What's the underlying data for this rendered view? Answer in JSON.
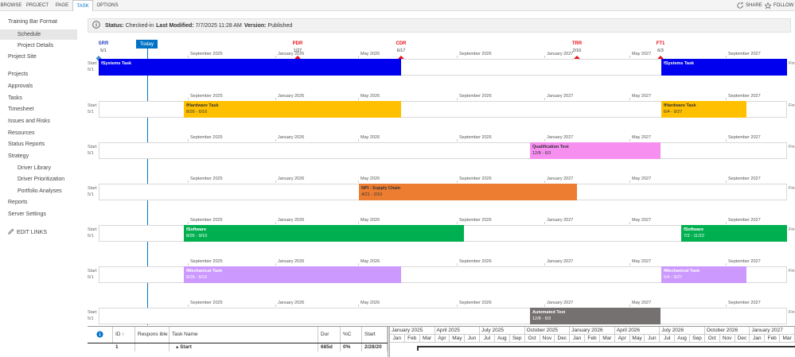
{
  "ribbon": {
    "tabs": [
      {
        "label": "BROWSE",
        "active": false
      },
      {
        "label": "PROJECT",
        "active": false
      },
      {
        "label": "PAGE",
        "active": false
      },
      {
        "label": "TASK",
        "active": true
      },
      {
        "label": "OPTIONS",
        "active": false
      }
    ],
    "share_label": "SHARE",
    "follow_label": "FOLLOW"
  },
  "nav": {
    "items": [
      {
        "label": "Training Bar Format",
        "level": 0,
        "selected": false
      },
      {
        "label": "Schedule",
        "level": 1,
        "selected": true
      },
      {
        "label": "Project Details",
        "level": 1,
        "selected": false
      },
      {
        "label": "Project Site",
        "level": 0,
        "selected": false
      },
      {
        "label": "Projects",
        "level": 0,
        "selected": false
      },
      {
        "label": "Approvals",
        "level": 0,
        "selected": false
      },
      {
        "label": "Tasks",
        "level": 0,
        "selected": false
      },
      {
        "label": "Timesheet",
        "level": 0,
        "selected": false
      },
      {
        "label": "Issues and Risks",
        "level": 0,
        "selected": false
      },
      {
        "label": "Resources",
        "level": 0,
        "selected": false
      },
      {
        "label": "Status Reports",
        "level": 0,
        "selected": false
      },
      {
        "label": "Strategy",
        "level": 0,
        "selected": false
      },
      {
        "label": "Driver Library",
        "level": 1,
        "selected": false
      },
      {
        "label": "Driver Prioritization",
        "level": 1,
        "selected": false
      },
      {
        "label": "Portfolio Analyses",
        "level": 1,
        "selected": false
      },
      {
        "label": "Reports",
        "level": 0,
        "selected": false
      },
      {
        "label": "Server Settings",
        "level": 0,
        "selected": false
      }
    ],
    "edit_links": "EDIT LINKS"
  },
  "status": {
    "status_label": "Status:",
    "status_value": "Checked-in",
    "modified_label": "Last Modified:",
    "modified_value": "7/7/2025 11:28 AM",
    "version_label": "Version:",
    "version_value": "Published"
  },
  "timeline": {
    "today_label": "Today",
    "start_label": "Start",
    "start_date": "5/1",
    "finish_label": "Fin",
    "milestones": [
      {
        "name": "SRR",
        "date": "5/1",
        "color": "#1f3fbf",
        "diamond_color": "#4a90c8"
      },
      {
        "name": "PDR",
        "date": "1/27",
        "color": "#e8141b",
        "diamond_color": "#e8141b"
      },
      {
        "name": "CDR",
        "date": "6/17",
        "color": "#e8141b",
        "diamond_color": "#e8141b"
      },
      {
        "name": "TRR",
        "date": "2/10",
        "color": "#e8141b",
        "diamond_color": "#e8141b"
      },
      {
        "name": "FT1",
        "date": "6/3",
        "color": "#e8141b",
        "diamond_color": "#e8141b"
      }
    ],
    "month_labels": [
      "September 2025",
      "January 2026",
      "May 2026",
      "September 2026",
      "January 2027",
      "May 2027",
      "September 2027"
    ],
    "rows": [
      {
        "bars": [
          {
            "name": "fSystems Task",
            "dates": "",
            "color": "#0000ee",
            "text_color": "#ffffff"
          },
          {
            "name": "fSystems Task",
            "dates": "",
            "color": "#0000ee",
            "text_color": "#ffffff"
          }
        ]
      },
      {
        "bars": [
          {
            "name": "fHardware Task",
            "dates": "8/26 - 6/16",
            "color": "#ffc000",
            "text_color": "#333333"
          },
          {
            "name": "fHardware Task",
            "dates": "6/4 - 9/27",
            "color": "#ffc000",
            "text_color": "#333333"
          }
        ]
      },
      {
        "bars": [
          {
            "name": "Qualification Test",
            "dates": "12/8 - 6/3",
            "color": "#f78ff0",
            "text_color": "#333333"
          }
        ]
      },
      {
        "bars": [
          {
            "name": "NPI - Supply Chain",
            "dates": "4/21 - 2/10",
            "color": "#ed7d31",
            "text_color": "#333333"
          }
        ]
      },
      {
        "bars": [
          {
            "name": "fSoftware",
            "dates": "8/26 - 9/10",
            "color": "#00b050",
            "text_color": "#ffffff"
          },
          {
            "name": "fSoftware",
            "dates": "7/2 - 11/22",
            "color": "#00b050",
            "text_color": "#ffffff"
          }
        ]
      },
      {
        "bars": [
          {
            "name": "fMechanical Task",
            "dates": "8/26 - 6/16",
            "color": "#cc99ff",
            "text_color": "#ffffff"
          },
          {
            "name": "fMechanical Task",
            "dates": "6/4 - 9/27",
            "color": "#cc99ff",
            "text_color": "#ffffff"
          }
        ]
      },
      {
        "bars": [
          {
            "name": "Automated Test",
            "dates": "12/8 - 6/3",
            "color": "#767171",
            "text_color": "#ffffff"
          }
        ]
      }
    ]
  },
  "grid": {
    "headers": [
      "ID ↑",
      "Respons ible",
      "Task Name",
      "Dur",
      "%C",
      "Start"
    ],
    "row": {
      "id": "1",
      "responsible": "",
      "task_name": "▴ Start",
      "duration": "685d",
      "percent": "0%",
      "start": "2/28/20"
    },
    "quarters": [
      "January 2025",
      "April 2025",
      "July 2025",
      "October 2025",
      "January 2026",
      "April 2026",
      "July 2026",
      "October 2026",
      "January 2027"
    ],
    "months": [
      "Jan",
      "Feb",
      "Mar",
      "Apr",
      "May",
      "Jun",
      "Jul",
      "Aug",
      "Sep",
      "Oct",
      "Nov",
      "Dec",
      "Jan",
      "Feb",
      "Mar",
      "Apr",
      "May",
      "Jun",
      "Jul",
      "Aug",
      "Sep",
      "Oct",
      "Nov",
      "Dec",
      "Jan",
      "Feb",
      "Mar"
    ]
  }
}
